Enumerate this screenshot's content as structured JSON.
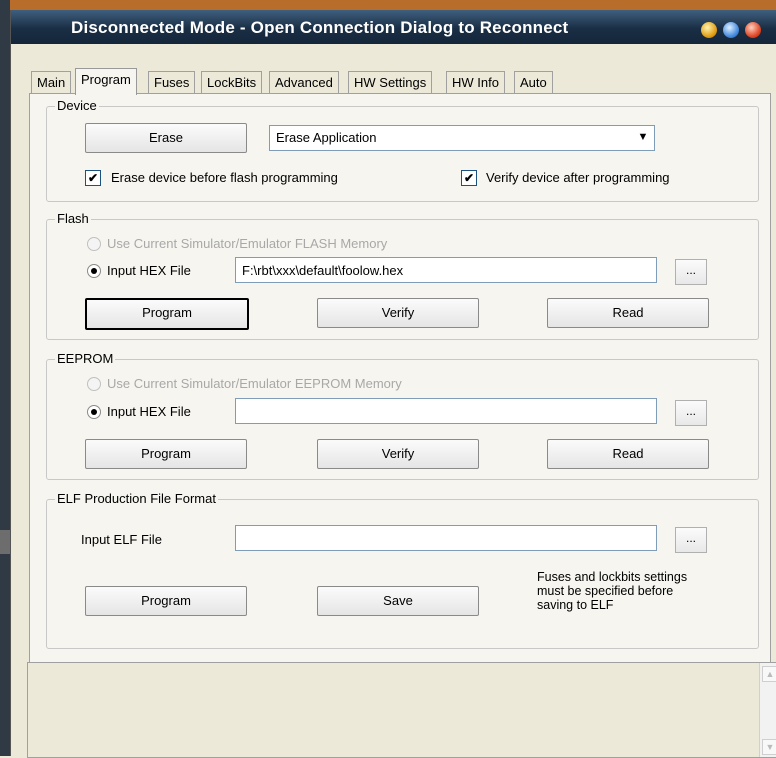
{
  "window": {
    "title": "Disconnected Mode - Open Connection Dialog to Reconnect"
  },
  "tabs": [
    "Main",
    "Program",
    "Fuses",
    "LockBits",
    "Advanced",
    "HW Settings",
    "HW Info",
    "Auto"
  ],
  "active_tab": "Program",
  "device": {
    "group_label": "Device",
    "erase_button": "Erase",
    "erase_mode_selected": "Erase Application",
    "erase_before_flash_label": "Erase device before flash programming",
    "erase_before_flash_checked": true,
    "verify_after_label": "Verify device after programming",
    "verify_after_checked": true
  },
  "flash": {
    "group_label": "Flash",
    "use_sim_label": "Use Current Simulator/Emulator FLASH Memory",
    "input_hex_label": "Input HEX File",
    "hex_path": "F:\\rbt\\xxx\\default\\foolow.hex",
    "browse_label": "...",
    "program_button": "Program",
    "verify_button": "Verify",
    "read_button": "Read"
  },
  "eeprom": {
    "group_label": "EEPROM",
    "use_sim_label": "Use Current Simulator/Emulator EEPROM Memory",
    "input_hex_label": "Input HEX File",
    "hex_path": "",
    "browse_label": "...",
    "program_button": "Program",
    "verify_button": "Verify",
    "read_button": "Read"
  },
  "elf": {
    "group_label": "ELF Production File Format",
    "input_label": "Input ELF File",
    "path": "",
    "browse_label": "...",
    "program_button": "Program",
    "save_button": "Save",
    "note_line1": "Fuses and lockbits settings",
    "note_line2": "must be specified before",
    "note_line3": "saving to ELF"
  },
  "colors": {
    "title_bar": "#1a2e44",
    "dialog_bg": "#ece9d8",
    "panel_bg": "#f6f5ef"
  }
}
